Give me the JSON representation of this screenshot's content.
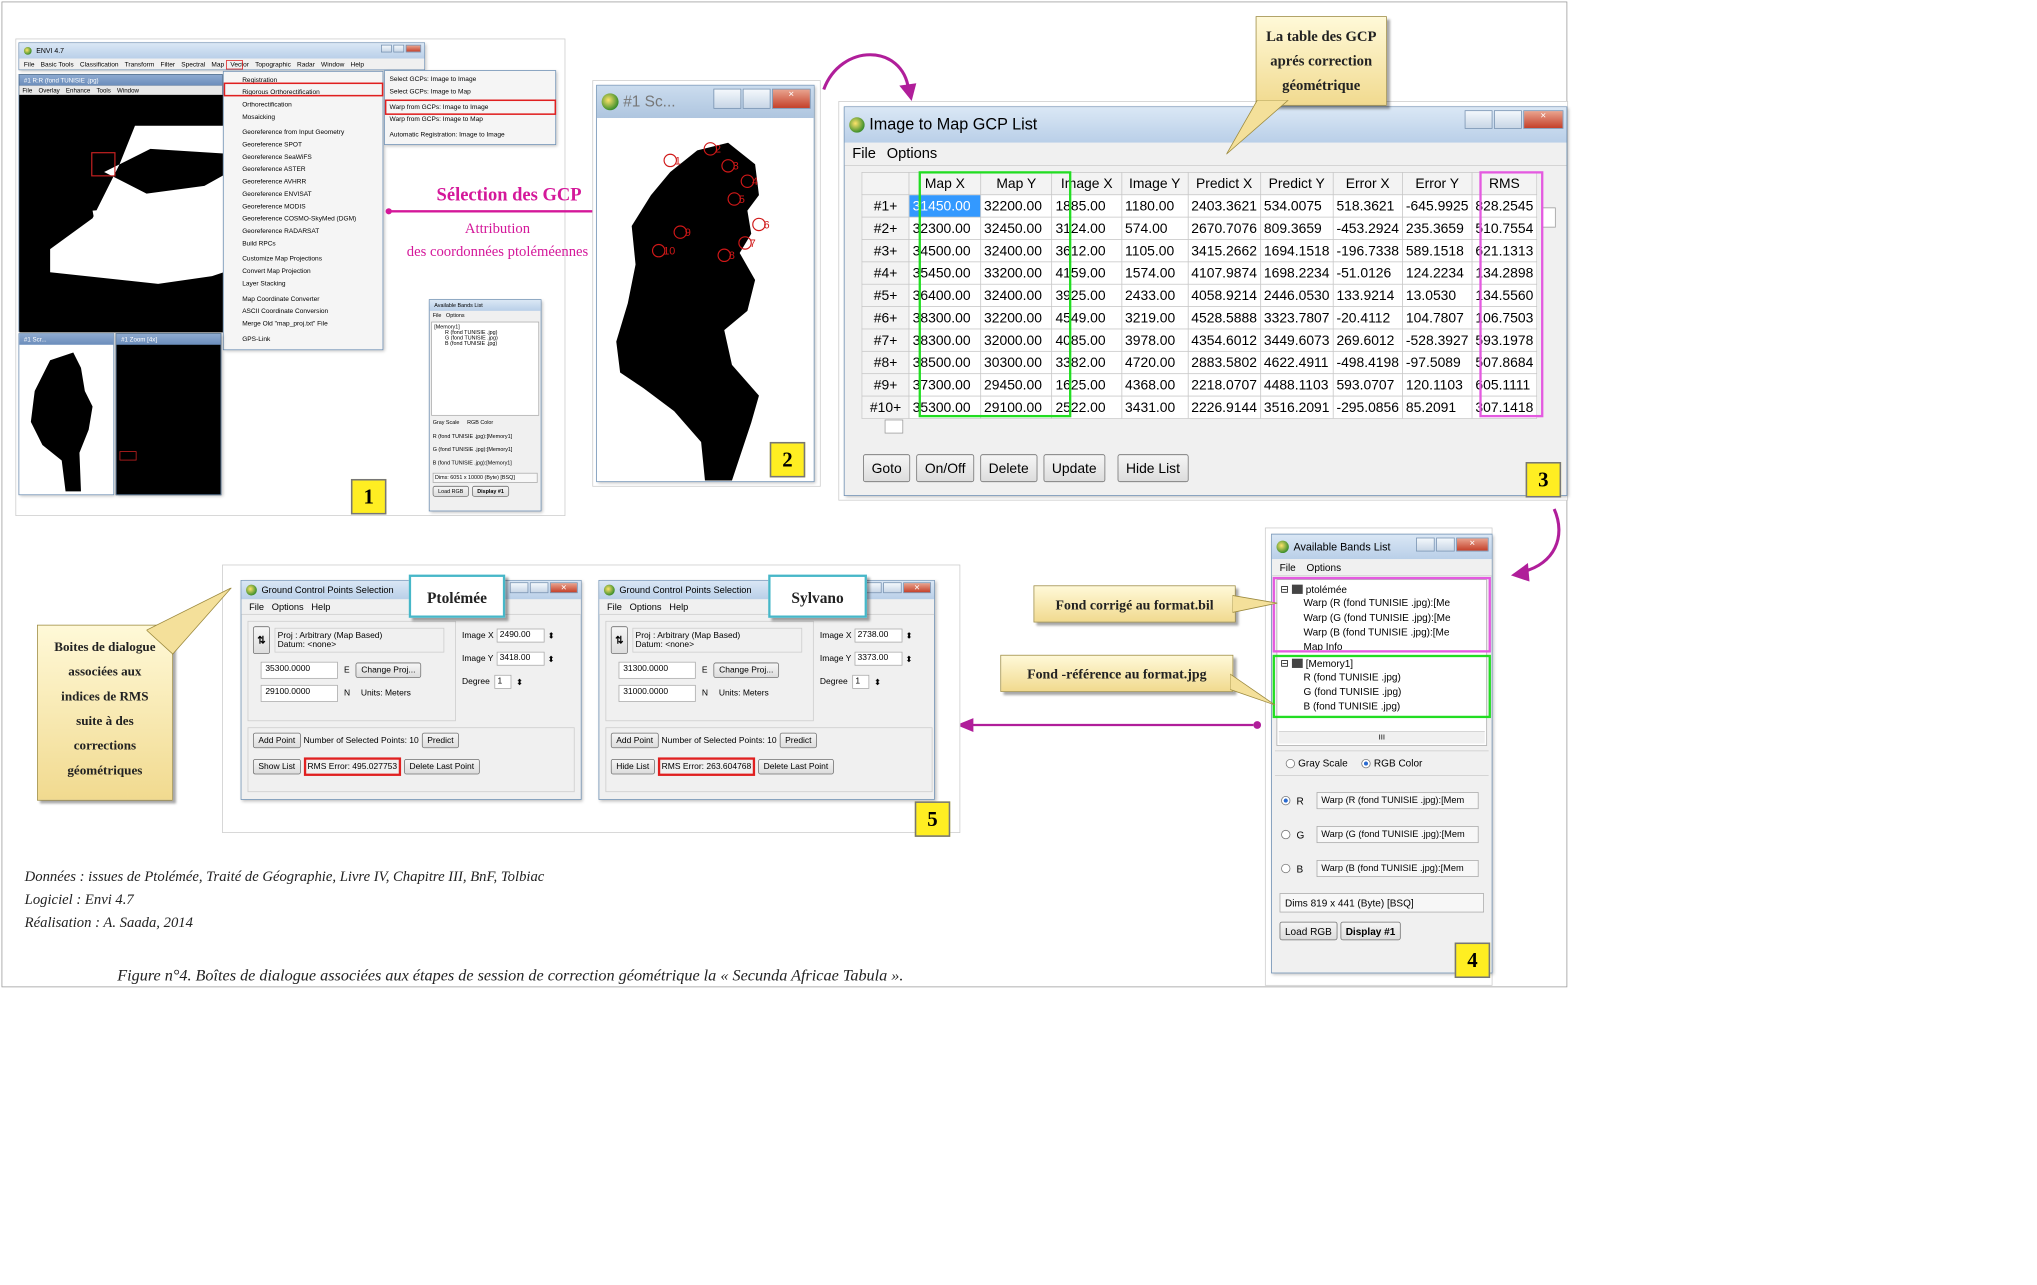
{
  "labels": {
    "gcp_select_title": "Sélection des GCP",
    "attribution_1": "Attribution",
    "attribution_2": "des coordonnées ptoléméennes"
  },
  "panel_numbers": [
    "1",
    "2",
    "3",
    "4",
    "5"
  ],
  "panel1": {
    "envi_title": "ENVI 4.7",
    "envi_menus": [
      "File",
      "Basic Tools",
      "Classification",
      "Transform",
      "Filter",
      "Spectral",
      "Map",
      "Vector",
      "Topographic",
      "Radar",
      "Window",
      "Help"
    ],
    "display_title": "#1 R:R (fond TUNISIE .jpg)",
    "display_menus": [
      "File",
      "Overlay",
      "Enhance",
      "Tools",
      "Window"
    ],
    "map_menu": [
      "Registration",
      "Rigorous Orthorectification",
      "Orthorectification",
      "Mosaicking",
      "",
      "Georeference from Input Geometry",
      "Georeference SPOT",
      "Georeference SeaWiFS",
      "Georeference ASTER",
      "Georeference AVHRR",
      "Georeference ENVISAT",
      "Georeference MODIS",
      "Georeference COSMO-SkyMed (DGM)",
      "Georeference RADARSAT",
      "Build RPCs",
      "",
      "Customize Map Projections",
      "Convert Map Projection",
      "Layer Stacking",
      "",
      "Map Coordinate Converter",
      "ASCII Coordinate Conversion",
      "Merge Old \"map_proj.txt\" File",
      "",
      "GPS-Link"
    ],
    "registration_submenu": [
      "Select GCPs: Image to Image",
      "Select GCPs: Image to Map",
      "",
      "Warp from GCPs: Image to Image",
      "Warp from GCPs: Image to Map",
      "",
      "Automatic Registration: Image to Image"
    ],
    "scroll_title": "#1 Scr...",
    "zoom_title": "#1 Zoom [4x]",
    "bands_title": "Available Bands List",
    "bands_menu": [
      "File",
      "Options"
    ],
    "bands_tree": [
      "[Memory1]",
      "R (fond TUNISIE .jpg)",
      "G (fond TUNISIE .jpg)",
      "B (fond TUNISIE .jpg)"
    ],
    "bands_mode": [
      "Gray Scale",
      "RGB Color"
    ],
    "bands_rgb": [
      "R (fond TUNISIE .jpg):[Memory1]",
      "G (fond TUNISIE .jpg):[Memory1]",
      "B (fond TUNISIE .jpg):[Memory1]"
    ],
    "bands_dims": "Dims: 6051 x 10000 (Byte) [BSQ]",
    "load_rgb": "Load RGB",
    "display_btn": "Display #1"
  },
  "panel2": {
    "title": "#1 Sc...",
    "gcp_labels": [
      "1",
      "2",
      "3",
      "4",
      "5",
      "6",
      "7",
      "8",
      "9",
      "10"
    ]
  },
  "panel3": {
    "callout": [
      "La table des GCP",
      "aprés correction",
      "géométrique"
    ],
    "title": "Image to Map GCP List",
    "menus": [
      "File",
      "Options"
    ],
    "columns": [
      "Map X",
      "Map Y",
      "Image X",
      "Image Y",
      "Predict X",
      "Predict Y",
      "Error X",
      "Error Y",
      "RMS"
    ],
    "rows": [
      [
        "#1+",
        "31450.00",
        "32200.00",
        "1885.00",
        "1180.00",
        "2403.3621",
        "534.0075",
        "518.3621",
        "-645.9925",
        "828.2545"
      ],
      [
        "#2+",
        "32300.00",
        "32450.00",
        "3124.00",
        "574.00",
        "2670.7076",
        "809.3659",
        "-453.2924",
        "235.3659",
        "510.7554"
      ],
      [
        "#3+",
        "34500.00",
        "32400.00",
        "3612.00",
        "1105.00",
        "3415.2662",
        "1694.1518",
        "-196.7338",
        "589.1518",
        "621.1313"
      ],
      [
        "#4+",
        "35450.00",
        "33200.00",
        "4159.00",
        "1574.00",
        "4107.9874",
        "1698.2234",
        "-51.0126",
        "124.2234",
        "134.2898"
      ],
      [
        "#5+",
        "36400.00",
        "32400.00",
        "3925.00",
        "2433.00",
        "4058.9214",
        "2446.0530",
        "133.9214",
        "13.0530",
        "134.5560"
      ],
      [
        "#6+",
        "38300.00",
        "32200.00",
        "4549.00",
        "3219.00",
        "4528.5888",
        "3323.7807",
        "-20.4112",
        "104.7807",
        "106.7503"
      ],
      [
        "#7+",
        "38300.00",
        "32000.00",
        "4085.00",
        "3978.00",
        "4354.6012",
        "3449.6073",
        "269.6012",
        "-528.3927",
        "593.1978"
      ],
      [
        "#8+",
        "38500.00",
        "30300.00",
        "3382.00",
        "4720.00",
        "2883.5802",
        "4622.4911",
        "-498.4198",
        "-97.5089",
        "507.8684"
      ],
      [
        "#9+",
        "37300.00",
        "29450.00",
        "1625.00",
        "4368.00",
        "2218.0707",
        "4488.1103",
        "593.0707",
        "120.1103",
        "605.1111"
      ],
      [
        "#10+",
        "35300.00",
        "29100.00",
        "2522.00",
        "3431.00",
        "2226.9144",
        "3516.2091",
        "-295.0856",
        "85.2091",
        "307.1418"
      ]
    ],
    "buttons": [
      "Goto",
      "On/Off",
      "Delete",
      "Update",
      "Hide List"
    ]
  },
  "panel4": {
    "title": "Available Bands List",
    "menus": [
      "File",
      "Options"
    ],
    "callout_bil": "Fond corrigé au format.bil",
    "callout_jpg": "Fond -référence au format.jpg",
    "tree_root1": "ptolémée",
    "tree1": [
      "Warp (R (fond TUNISIE .jpg):[Me",
      "Warp (G (fond TUNISIE .jpg):[Me",
      "Warp (B (fond TUNISIE .jpg):[Me",
      "Map Info"
    ],
    "tree_root2": "[Memory1]",
    "tree2": [
      "R (fond TUNISIE .jpg)",
      "G (fond TUNISIE .jpg)",
      "B (fond TUNISIE .jpg)"
    ],
    "scroll_glyph": "III",
    "mode": [
      "Gray Scale",
      "RGB Color"
    ],
    "rgb_letters": [
      "R",
      "G",
      "B"
    ],
    "rgb_values": [
      "Warp (R (fond TUNISIE .jpg):[Mem",
      "Warp (G (fond TUNISIE .jpg):[Mem",
      "Warp (B (fond TUNISIE .jpg):[Mem"
    ],
    "dims": "Dims 819 x 441 (Byte) [BSQ]",
    "load_rgb": "Load RGB",
    "display_btn": "Display #1"
  },
  "panel5": {
    "callout": [
      "Boites de dialogue",
      "associées aux",
      "indices de RMS",
      "suite à des",
      "corrections",
      "géométriques"
    ],
    "dialogs": [
      {
        "title": "Ground Control Points Selection",
        "tag": "Ptolémée",
        "menus": [
          "File",
          "Options",
          "Help"
        ],
        "proj": "Proj : Arbitrary (Map Based)",
        "datum": "Datum: <none>",
        "e_val": "35300.0000",
        "e_lbl": "E",
        "n_val": "29100.0000",
        "n_lbl": "N",
        "change_proj": "Change Proj...",
        "units": "Units: Meters",
        "imgx_lbl": "Image X",
        "imgx": "2490.00",
        "imgy_lbl": "Image Y",
        "imgy": "3418.00",
        "degree_lbl": "Degree",
        "degree": "1",
        "add_point": "Add Point",
        "num_sel": "Number of Selected Points: 10",
        "predict": "Predict",
        "list_btn": "Show List",
        "rms": "RMS Error: 495.027753",
        "delete_last": "Delete Last Point"
      },
      {
        "title": "Ground Control Points Selection",
        "tag": "Sylvano",
        "menus": [
          "File",
          "Options",
          "Help"
        ],
        "proj": "Proj : Arbitrary (Map Based)",
        "datum": "Datum: <none>",
        "e_val": "31300.0000",
        "e_lbl": "E",
        "n_val": "31000.0000",
        "n_lbl": "N",
        "change_proj": "Change Proj...",
        "units": "Units: Meters",
        "imgx_lbl": "Image X",
        "imgx": "2738.00",
        "imgy_lbl": "Image Y",
        "imgy": "3373.00",
        "degree_lbl": "Degree",
        "degree": "1",
        "add_point": "Add Point",
        "num_sel": "Number of Selected Points: 10",
        "predict": "Predict",
        "list_btn": "Hide List",
        "rms": "RMS Error: 263.604768",
        "delete_last": "Delete Last Point"
      }
    ]
  },
  "credits": [
    "Données : issues de Ptolémée, Traité de Géographie, Livre IV, Chapitre III, BnF, Tolbiac",
    "Logiciel : Envi 4.7",
    "Réalisation : A. Saada, 2014"
  ],
  "figure_caption": "Figure n°4. Boîtes de dialogue associées aux étapes de session de correction géométrique la « Secunda Africae Tabula ».",
  "colors": {
    "accent_pink": "#d4189a",
    "red": "#e02020",
    "green": "#22dd22",
    "magenta_box": "#e45ae0",
    "callout_yellow": "#f4e09a"
  }
}
